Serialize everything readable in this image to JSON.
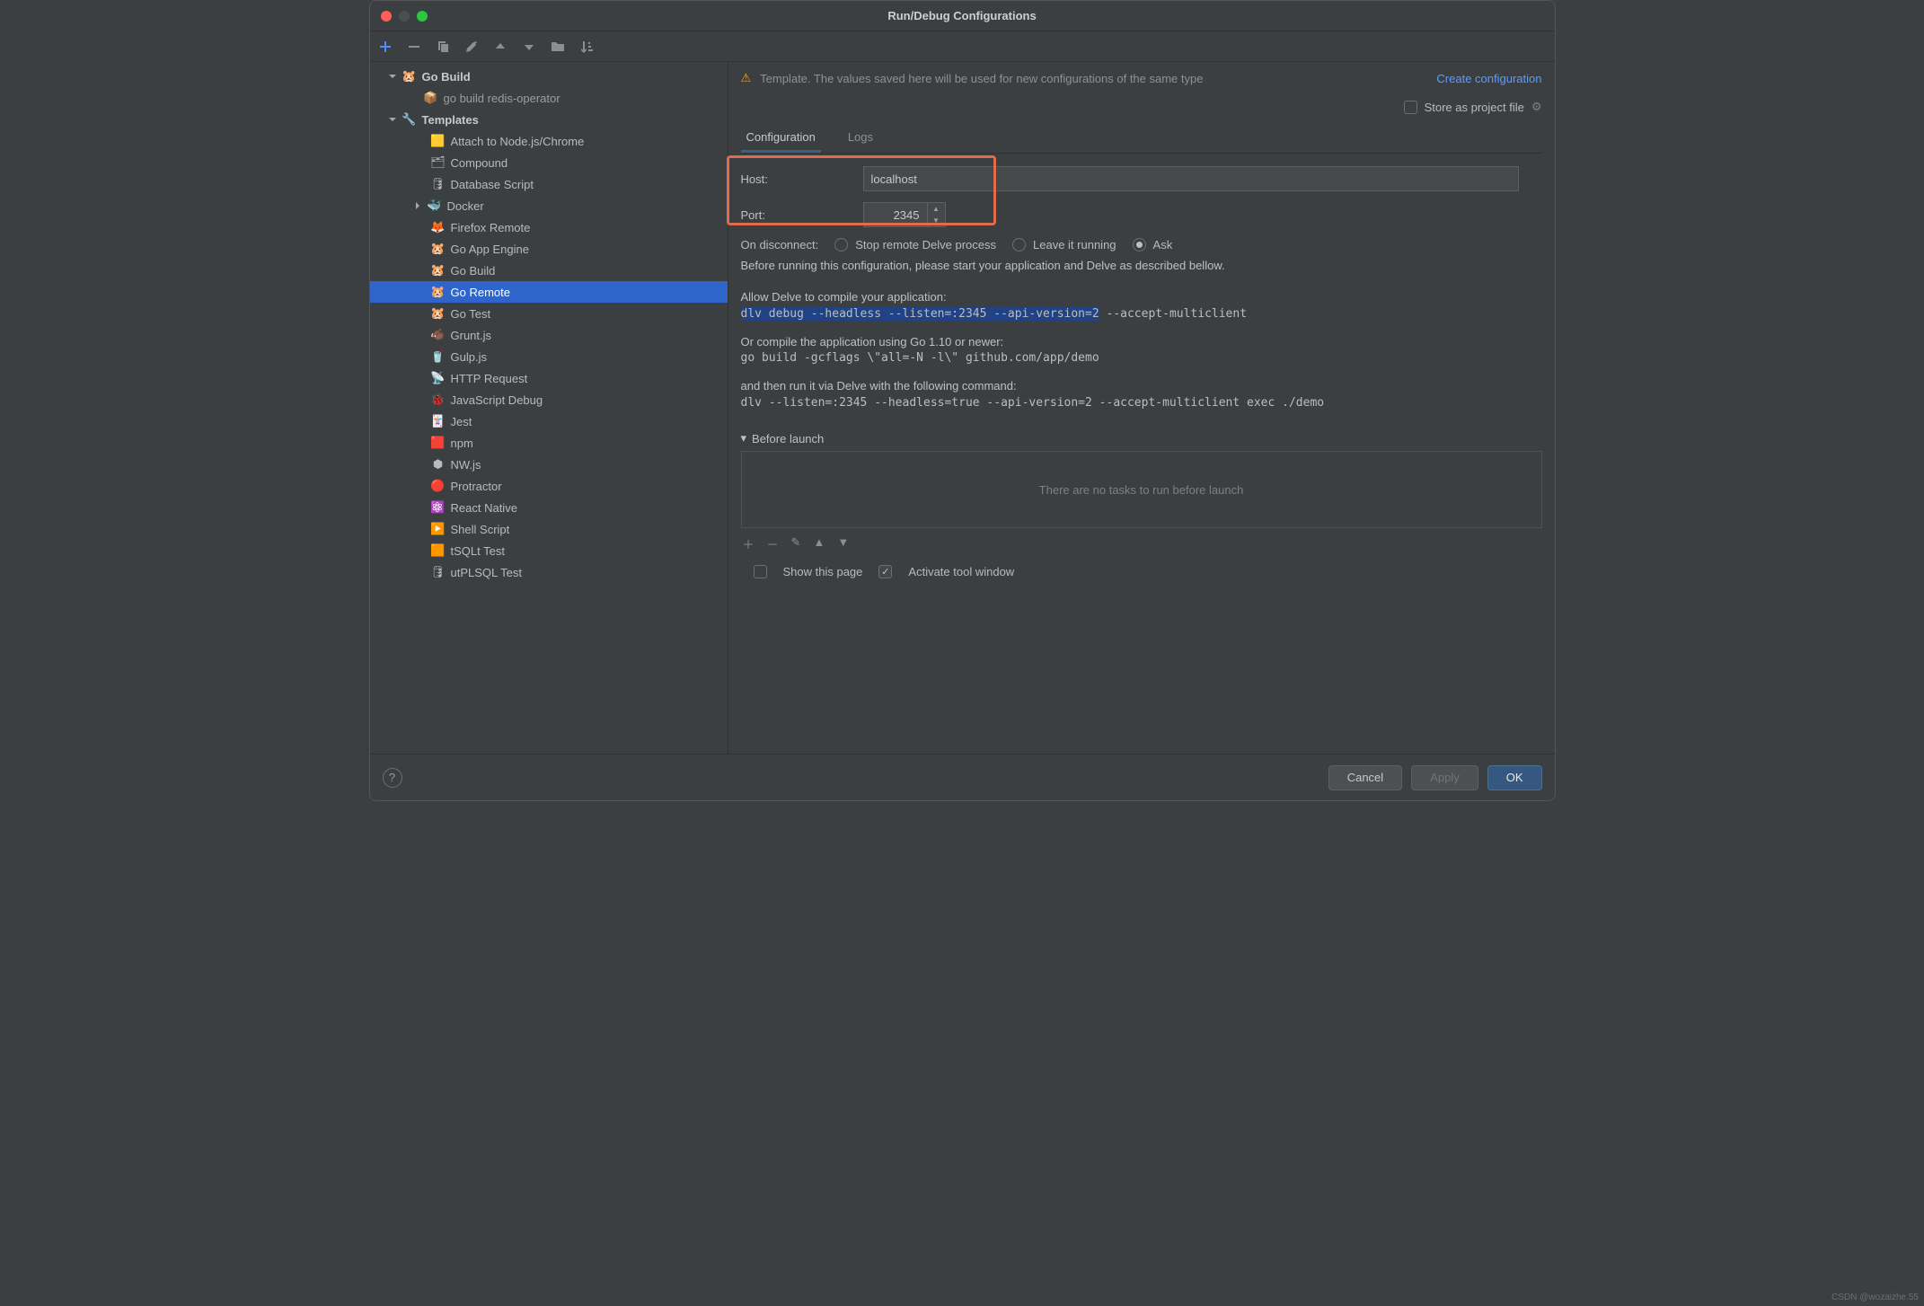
{
  "title": "Run/Debug Configurations",
  "banner": {
    "text": "Template. The values saved here will be used for new configurations of the same type",
    "link": "Create configuration"
  },
  "store_label": "Store as project file",
  "tree": {
    "go_build": "Go Build",
    "go_build_child": "go build redis-operator",
    "templates": "Templates",
    "items": [
      "Attach to Node.js/Chrome",
      "Compound",
      "Database Script",
      "Docker",
      "Firefox Remote",
      "Go App Engine",
      "Go Build",
      "Go Remote",
      "Go Test",
      "Grunt.js",
      "Gulp.js",
      "HTTP Request",
      "JavaScript Debug",
      "Jest",
      "npm",
      "NW.js",
      "Protractor",
      "React Native",
      "Shell Script",
      "tSQLt Test",
      "utPLSQL Test"
    ]
  },
  "tabs": {
    "configuration": "Configuration",
    "logs": "Logs"
  },
  "form": {
    "host_label": "Host:",
    "host_value": "localhost",
    "port_label": "Port:",
    "port_value": "2345",
    "disconnect_label": "On disconnect:",
    "opt_stop": "Stop remote Delve process",
    "opt_leave": "Leave it running",
    "opt_ask": "Ask",
    "before_running": "Before running this configuration, please start your application and Delve as described bellow.",
    "allow_delve": "Allow Delve to compile your application:",
    "cmd1a": "dlv debug --headless --listen=:2345 --api-version=2",
    "cmd1b": " --accept-multiclient",
    "or_compile": "Or compile the application using Go 1.10 or newer:",
    "cmd2": "go build -gcflags \\\"all=-N -l\\\" github.com/app/demo",
    "then_run": "and then run it via Delve with the following command:",
    "cmd3": "dlv --listen=:2345 --headless=true --api-version=2 --accept-multiclient exec ./demo"
  },
  "before_launch": {
    "title": "Before launch",
    "empty": "There are no tasks to run before launch",
    "show_page": "Show this page",
    "activate": "Activate tool window"
  },
  "buttons": {
    "cancel": "Cancel",
    "apply": "Apply",
    "ok": "OK"
  },
  "watermark": "CSDN @wozaizhe.55"
}
